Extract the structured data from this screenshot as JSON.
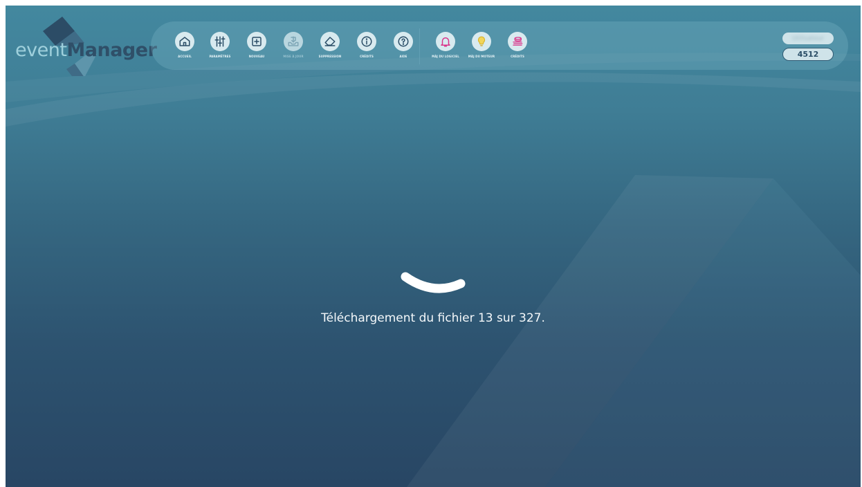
{
  "app": {
    "logo": {
      "part1": "event",
      "part2": "Manager"
    }
  },
  "toolbar": {
    "buttons": [
      {
        "id": "accueil",
        "label": "ACCUEIL",
        "icon": "home-icon",
        "enabled": true
      },
      {
        "id": "parametres",
        "label": "PARAMÈTRES",
        "icon": "sliders-icon",
        "enabled": true
      },
      {
        "id": "nouveau",
        "label": "NOUVEAU",
        "icon": "plus-square-icon",
        "enabled": true
      },
      {
        "id": "mise-a-jour",
        "label": "MISE À JOUR",
        "icon": "download-tray-icon",
        "enabled": false
      },
      {
        "id": "suppression",
        "label": "SUPPRESSION",
        "icon": "eraser-icon",
        "enabled": true
      },
      {
        "id": "credits",
        "label": "CRÉDITS",
        "icon": "info-icon",
        "enabled": true
      },
      {
        "id": "aide",
        "label": "AIDE",
        "icon": "question-icon",
        "enabled": true
      },
      {
        "id": "maj-logiciel",
        "label": "MÀJ DU LOGICIEL",
        "icon": "bell-icon",
        "enabled": true
      },
      {
        "id": "maj-moteur",
        "label": "MÀJ DU MOTEUR",
        "icon": "lightbulb-icon",
        "enabled": true
      },
      {
        "id": "credits-2",
        "label": "CRÉDITS",
        "icon": "coins-icon",
        "enabled": true
      }
    ],
    "user_pill": "Utilisateur",
    "code_pill": "4512"
  },
  "colors": {
    "icon_primary": "#2a4d66",
    "icon_bell": "#d9358a",
    "icon_bulb": "#e6c43a",
    "icon_credits": "#d9358a",
    "circle_bg": "#d8eaef",
    "disabled_circle": "#b9d6df"
  },
  "loader": {
    "message": "Téléchargement du fichier 13 sur 327.",
    "current_file": 13,
    "total_files": 327
  }
}
